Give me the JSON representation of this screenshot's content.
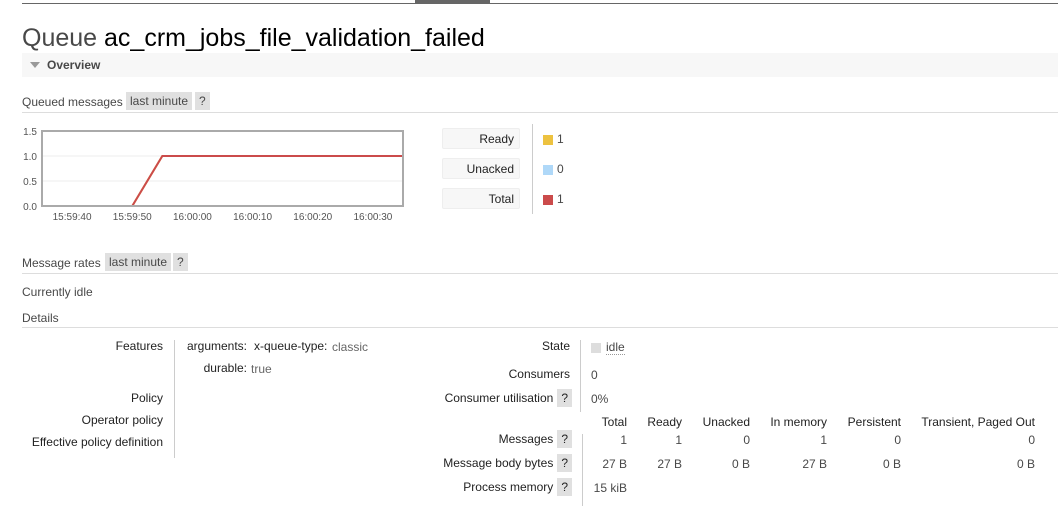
{
  "header": {
    "kind": "Queue",
    "name": "ac_crm_jobs_file_validation_failed"
  },
  "overview": {
    "label": "Overview",
    "queued_messages": {
      "label": "Queued messages",
      "range": "last minute",
      "help": "?"
    },
    "legend": [
      {
        "label": "Ready",
        "value": "1",
        "color": "#edc240"
      },
      {
        "label": "Unacked",
        "value": "0",
        "color": "#afd8f8"
      },
      {
        "label": "Total",
        "value": "1",
        "color": "#cb4b4b"
      }
    ],
    "message_rates": {
      "label": "Message rates",
      "range": "last minute",
      "help": "?"
    },
    "currently_idle": "Currently idle"
  },
  "chart_data": {
    "type": "line",
    "title": "Queued messages",
    "xlabel": "",
    "ylabel": "",
    "x_ticks": [
      "15:59:40",
      "15:59:50",
      "16:00:00",
      "16:00:10",
      "16:00:20",
      "16:00:30"
    ],
    "y_ticks": [
      "0.0",
      "0.5",
      "1.0",
      "1.5"
    ],
    "ylim": [
      0,
      1.5
    ],
    "xlim_seconds": [
      -5,
      55
    ],
    "x_origin": "15:59:40",
    "grid": true,
    "series": [
      {
        "name": "Ready",
        "color": "#edc240",
        "points": [
          [
            -5,
            0
          ],
          [
            10,
            0
          ],
          [
            15,
            1
          ],
          [
            55,
            1
          ]
        ]
      },
      {
        "name": "Unacked",
        "color": "#afd8f8",
        "points": [
          [
            -5,
            0
          ],
          [
            55,
            0
          ]
        ]
      },
      {
        "name": "Total",
        "color": "#cb4b4b",
        "points": [
          [
            -5,
            0
          ],
          [
            10,
            0
          ],
          [
            15,
            1
          ],
          [
            55,
            1
          ]
        ]
      }
    ]
  },
  "details": {
    "label": "Details",
    "left": [
      {
        "label": "Features"
      },
      {
        "label": "Policy"
      },
      {
        "label": "Operator policy"
      },
      {
        "label": "Effective policy definition"
      }
    ],
    "features": {
      "arguments_label": "arguments:",
      "queue_type_key": "x-queue-type:",
      "queue_type_value": "classic",
      "durable_label": "durable:",
      "durable_value": "true"
    },
    "state": {
      "label": "State",
      "value": "idle"
    },
    "consumers": {
      "label": "Consumers",
      "value": "0"
    },
    "consumer_utilisation": {
      "label": "Consumer utilisation",
      "help": "?",
      "value": "0%"
    },
    "table": {
      "columns": [
        "Total",
        "Ready",
        "Unacked",
        "In memory",
        "Persistent",
        "Transient, Paged Out"
      ],
      "rows": [
        {
          "label": "Messages",
          "help": "?",
          "values": [
            "1",
            "1",
            "0",
            "1",
            "0",
            "0"
          ]
        },
        {
          "label": "Message body bytes",
          "help": "?",
          "values": [
            "27 B",
            "27 B",
            "0 B",
            "27 B",
            "0 B",
            "0 B"
          ]
        },
        {
          "label": "Process memory",
          "help": "?",
          "values": [
            "15 kiB"
          ]
        }
      ]
    }
  }
}
